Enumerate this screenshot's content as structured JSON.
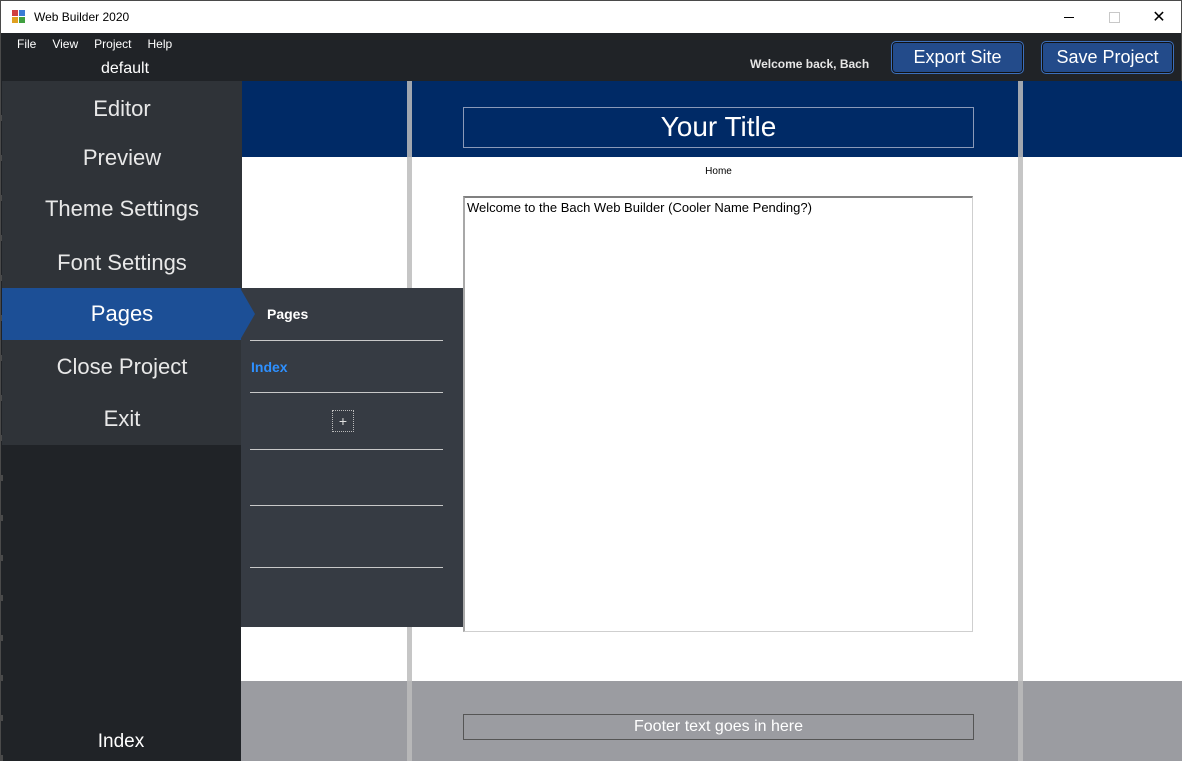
{
  "window": {
    "title": "Web Builder 2020",
    "close_glyph": "✕"
  },
  "menu": [
    "File",
    "View",
    "Project",
    "Help"
  ],
  "header": {
    "project_name": "default",
    "welcome": "Welcome back, Bach",
    "export_label": "Export Site",
    "save_label": "Save Project"
  },
  "sidebar": {
    "items": [
      {
        "label": "Editor"
      },
      {
        "label": "Preview"
      },
      {
        "label": "Theme Settings"
      },
      {
        "label": "Font Settings"
      },
      {
        "label": "Pages",
        "active": true
      },
      {
        "label": "Close Project"
      },
      {
        "label": "Exit"
      }
    ],
    "current_page": "Index"
  },
  "pages_panel": {
    "title": "Pages",
    "pages": [
      "Index"
    ],
    "add_glyph": "+"
  },
  "site": {
    "title": "Your Title",
    "nav": "Home",
    "content": "Welcome to the Bach Web Builder (Cooler Name Pending?)",
    "footer": "Footer text goes in here"
  },
  "colors": {
    "accent": "#1c4f96",
    "header_band": "#002a66",
    "footer_band": "#9b9ca1",
    "page_link": "#2e90ff"
  }
}
